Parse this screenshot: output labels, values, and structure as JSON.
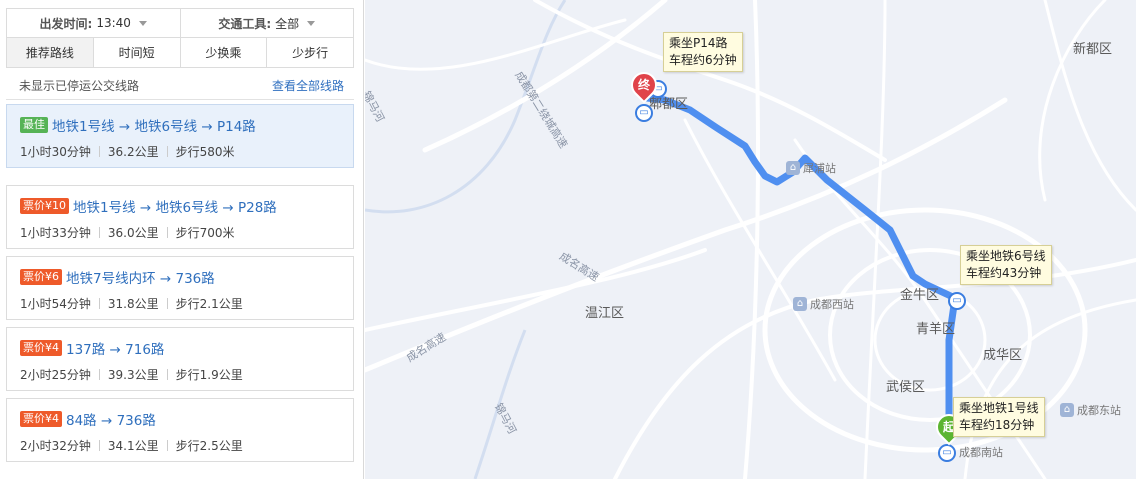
{
  "filters": {
    "depart_label": "出发时间:",
    "depart_value": "13:40",
    "transport_label": "交通工具:",
    "transport_value": "全部"
  },
  "tabs": [
    "推荐路线",
    "时间短",
    "少换乘",
    "少步行"
  ],
  "notice": {
    "text": "未显示已停运公交线路",
    "link": "查看全部线路"
  },
  "routes": [
    {
      "badge": "最佳",
      "badge_type": "best",
      "title": "地铁1号线 → 地铁6号线 → P14路",
      "duration": "1小时30分钟",
      "distance": "36.2公里",
      "walk": "步行580米"
    },
    {
      "badge": "票价¥10",
      "badge_type": "fare",
      "title": "地铁1号线 → 地铁6号线 → P28路",
      "duration": "1小时33分钟",
      "distance": "36.0公里",
      "walk": "步行700米"
    },
    {
      "badge": "票价¥6",
      "badge_type": "fare",
      "title": "地铁7号线内环 → 736路",
      "duration": "1小时54分钟",
      "distance": "31.8公里",
      "walk": "步行2.1公里"
    },
    {
      "badge": "票价¥4",
      "badge_type": "fare",
      "title": "137路 → 716路",
      "duration": "2小时25分钟",
      "distance": "39.3公里",
      "walk": "步行1.9公里"
    },
    {
      "badge": "票价¥4",
      "badge_type": "fare",
      "title": "84路 → 736路",
      "duration": "2小时32分钟",
      "distance": "34.1公里",
      "walk": "步行2.5公里"
    }
  ],
  "map": {
    "districts": [
      "新都区",
      "郫都区",
      "温江区",
      "金牛区",
      "青羊区",
      "成华区",
      "武侯区"
    ],
    "roads": [
      "成都第二绕城高速",
      "成名高速",
      "成名高速",
      "锦马河",
      "锦马河"
    ],
    "stations": [
      "犀浦站",
      "成都西站",
      "成都东站",
      "成都南站"
    ],
    "tips": [
      {
        "line1": "乘坐P14路",
        "line2": "车程约6分钟"
      },
      {
        "line1": "乘坐地铁6号线",
        "line2": "车程约43分钟"
      },
      {
        "line1": "乘坐地铁1号线",
        "line2": "车程约18分钟"
      }
    ],
    "start_marker": "起",
    "end_marker": "终",
    "route_color": "#4f8ff0"
  }
}
